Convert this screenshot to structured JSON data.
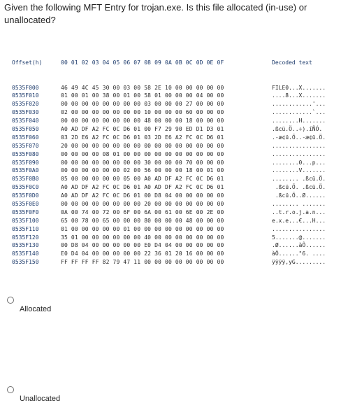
{
  "question": "Given the following MFT Entry for trojan.exe.  Is this file allocated (in-use) or unallocated?",
  "hexdump": {
    "header": {
      "offset": "Offset(h)",
      "hex": "00 01 02 03 04 05 06 07 08 09 0A 0B 0C 0D 0E 0F",
      "decoded": "Decoded text"
    },
    "rows": [
      {
        "offset": "0535F000",
        "hex": "46 49 4C 45 30 00 03 00 58 2E 10 00 00 00 00 00",
        "decoded": "FILE0...X......."
      },
      {
        "offset": "0535F010",
        "hex": "01 00 01 00 38 00 01 00 58 01 00 00 00 04 00 00",
        "decoded": "....8...X......."
      },
      {
        "offset": "0535F020",
        "hex": "00 00 00 00 00 00 00 00 03 00 00 00 27 00 00 00",
        "decoded": "............'..."
      },
      {
        "offset": "0535F030",
        "hex": "02 00 00 00 00 00 00 00 10 00 00 00 60 00 00 00",
        "decoded": "............`..."
      },
      {
        "offset": "0535F040",
        "hex": "00 00 00 00 00 00 00 00 48 00 00 00 18 00 00 00",
        "decoded": "........H......."
      },
      {
        "offset": "0535F050",
        "hex": "A0 AD DF A2 FC 0C D6 01 00 F7 29 90 ED D1 D3 01",
        "decoded": ".ßcü.Ö..÷).íÑÓ."
      },
      {
        "offset": "0535F060",
        "hex": "03 2D E6 A2 FC 0C D6 01 03 2D E6 A2 FC 0C D6 01",
        "decoded": ".-æ¢ü.Ö..-æ¢ü.Ö."
      },
      {
        "offset": "0535F070",
        "hex": "20 00 00 00 00 00 00 00 00 00 00 00 00 00 00 00",
        "decoded": "................"
      },
      {
        "offset": "0535F080",
        "hex": "00 00 00 00 08 01 00 00 00 00 00 00 00 00 00 00",
        "decoded": "................"
      },
      {
        "offset": "0535F090",
        "hex": "00 00 00 00 00 00 00 00 30 00 00 00 70 00 00 00",
        "decoded": "........0...p..."
      },
      {
        "offset": "0535F0A0",
        "hex": "00 00 00 00 00 00 02 00 56 00 00 00 18 00 01 00",
        "decoded": "........V......."
      },
      {
        "offset": "0535F0B0",
        "hex": "05 00 00 00 00 00 05 00 A0 AD DF A2 FC 0C D6 01",
        "decoded": "........ .ßcü.Ö."
      },
      {
        "offset": "0535F0C0",
        "hex": "A0 AD DF A2 FC 0C D6 01 A0 AD DF A2 FC 0C D6 01",
        "decoded": " .ßcü.Ö. .ßcü.Ö."
      },
      {
        "offset": "0535F0D0",
        "hex": "A0 AD DF A2 FC 0C D6 01 00 D8 04 00 00 00 00 00",
        "decoded": " .ßcü.Ö..Ø......"
      },
      {
        "offset": "0535F0E0",
        "hex": "00 00 00 00 00 00 00 00 20 00 00 00 00 00 00 00",
        "decoded": "........ ......."
      },
      {
        "offset": "0535F0F0",
        "hex": "0A 00 74 00 72 00 6F 00 6A 00 61 00 6E 00 2E 00",
        "decoded": "..t.r.o.j.a.n..."
      },
      {
        "offset": "0535F100",
        "hex": "65 00 78 00 65 00 00 00 80 00 00 00 48 00 00 00",
        "decoded": "e.x.e...€...H..."
      },
      {
        "offset": "0535F110",
        "hex": "01 00 00 00 00 00 01 00 00 00 00 00 00 00 00 00",
        "decoded": "................"
      },
      {
        "offset": "0535F120",
        "hex": "35 01 00 00 00 00 00 00 40 00 00 00 00 00 00 00",
        "decoded": "5.......@......."
      },
      {
        "offset": "0535F130",
        "hex": "00 D8 04 00 00 00 00 00 E0 D4 04 00 00 00 00 00",
        "decoded": ".Ø......àÔ......"
      },
      {
        "offset": "0535F140",
        "hex": "E0 D4 04 00 00 00 00 00 22 36 01 20 16 00 00 00",
        "decoded": "àÔ......\"6. ...."
      },
      {
        "offset": "0535F150",
        "hex": "FF FF FF FF 82 79 47 11 00 00 00 00 00 00 00 00",
        "decoded": "ÿÿÿÿ‚yG........."
      }
    ]
  },
  "options": [
    {
      "label": "Allocated"
    },
    {
      "label": "Unallocated"
    }
  ]
}
